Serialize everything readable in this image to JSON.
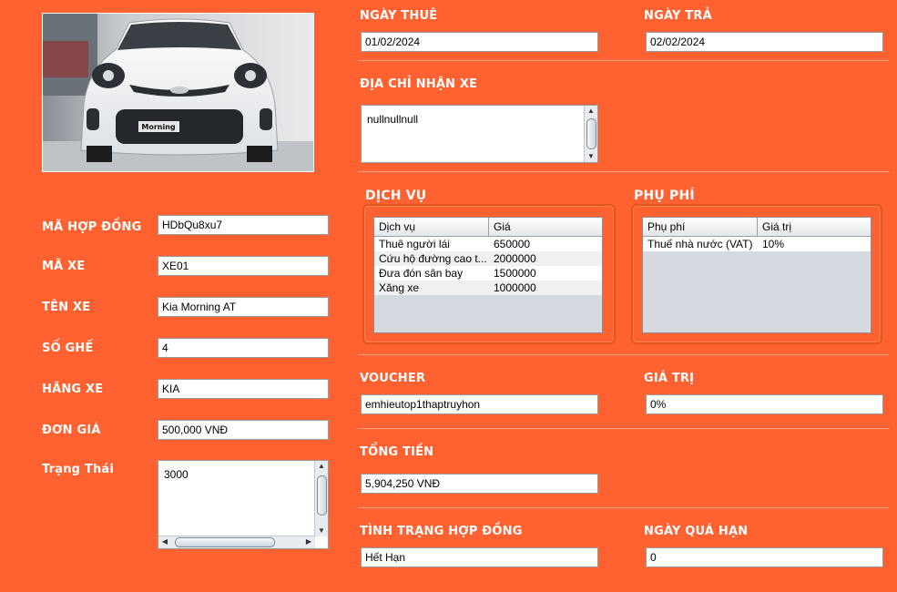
{
  "left": {
    "labels": {
      "contract_id": "MÃ HỢP ĐỒNG",
      "car_id": "MÃ XE",
      "car_name": "TÊN XE",
      "seats": "SỐ GHẾ",
      "brand": "HÃNG XE",
      "price": "ĐƠN GIÁ",
      "status": "Trạng Thái"
    },
    "values": {
      "contract_id": "HDbQu8xu7",
      "car_id": "XE01",
      "car_name": "Kia Morning AT",
      "seats": "4",
      "brand": "KIA",
      "price": "500,000 VNĐ",
      "status": "3000"
    },
    "car_plate_text": "Morning"
  },
  "right": {
    "rent_date_label": "NGÀY THUÊ",
    "rent_date": "01/02/2024",
    "return_date_label": "NGÀY TRẢ",
    "return_date": "02/02/2024",
    "address_label": "ĐỊA CHỈ NHẬN XE",
    "address": "nullnullnull",
    "services": {
      "title": "DỊCH VỤ",
      "columns": [
        "Dịch vụ",
        "Giá"
      ],
      "rows": [
        [
          "Thuê người lái",
          "650000"
        ],
        [
          "Cứu hộ đường cao t...",
          "2000000"
        ],
        [
          "Đưa đón sân bay",
          "1500000"
        ],
        [
          "Xăng xe",
          "1000000"
        ]
      ]
    },
    "fees": {
      "title": "PHỤ PHÍ",
      "columns": [
        "Phụ phí",
        "Giá trị"
      ],
      "rows": [
        [
          "Thuế nhà nước (VAT)",
          "10%"
        ]
      ]
    },
    "voucher_label": "VOUCHER",
    "voucher": "emhieutop1thaptruyhon",
    "value_label": "GIÁ TRỊ",
    "value": "0%",
    "total_label": "TỔNG TIỀN",
    "total": "5,904,250 VNĐ",
    "contract_status_label": "TÌNH TRẠNG HỢP ĐỒNG",
    "contract_status": "Hết Hạn",
    "overdue_label": "NGÀY QUÁ HẠN",
    "overdue": "0"
  },
  "colors": {
    "background": "#ff6230",
    "label_text": "#ffffff"
  }
}
